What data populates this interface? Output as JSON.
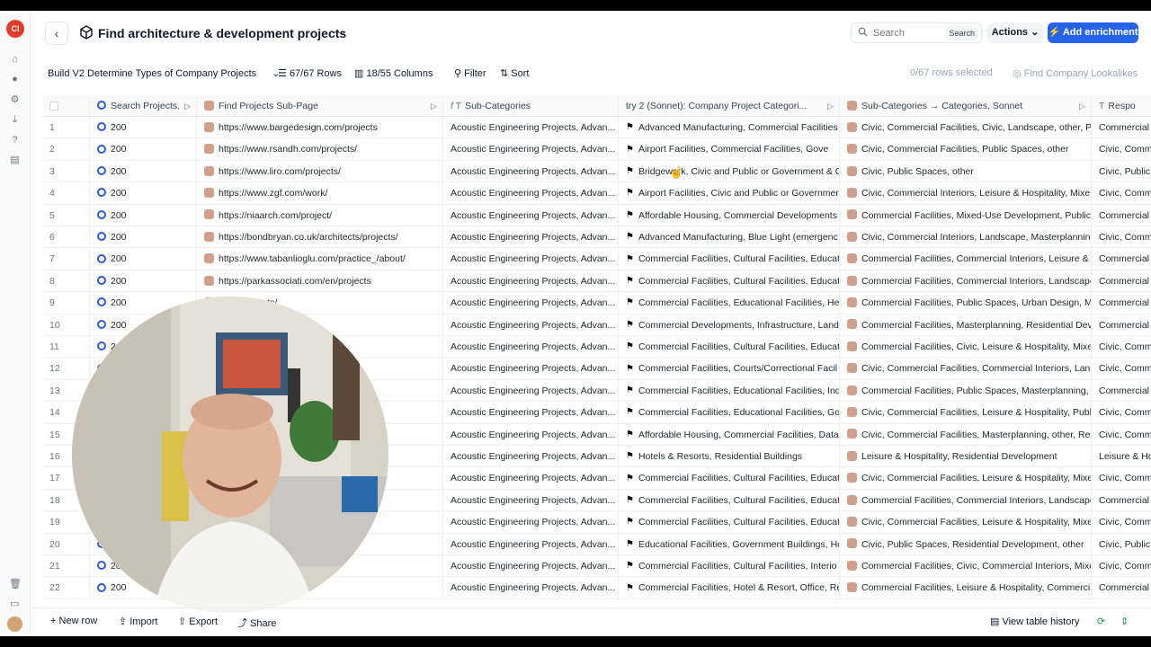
{
  "rail": {
    "logo": "Cl",
    "icons": [
      "home-icon",
      "bell-icon",
      "settings-icon",
      "download-icon",
      "help-icon",
      "table-icon",
      "trash-icon",
      "card-icon"
    ]
  },
  "header": {
    "title": "Find architecture & development projects",
    "more": "···",
    "search_placeholder": "Search",
    "search_button": "Search",
    "actions_label": "Actions",
    "enrich_label": "Add enrichment"
  },
  "toolbar": {
    "view_name": "Build V2 Determine Types of Company Projects",
    "rows": "67/67 Rows",
    "columns": "18/55 Columns",
    "filter": "Filter",
    "sort": "Sort",
    "selected": "0/67 rows selected",
    "lookalikes": "Find Company Lookalikes"
  },
  "columns": [
    "Search Projects.",
    "Find Projects Sub-Page",
    "Sub-Categories",
    "try 2 (Sonnet): Company Project Categori...",
    "Sub-Categories → Categories, Sonnet",
    "Respo"
  ],
  "rows": [
    {
      "n": "1",
      "status": "200",
      "url": "https://www.bargedesign.com/projects",
      "sub": "Acoustic Engineering Projects, Advan...",
      "cat": "Advanced Manufacturing, Commercial Facilities",
      "son": "Civic, Commercial Facilities, Civic, Landscape, other, Public S",
      "resp": "Commercial F"
    },
    {
      "n": "2",
      "status": "200",
      "url": "https://www.rsandh.com/projects/",
      "sub": "Acoustic Engineering Projects, Advan...",
      "cat": "Airport Facilities, Commercial Facilities, Gove",
      "son": "Civic, Commercial Facilities, Public Spaces, other",
      "resp": "Civic, Comme"
    },
    {
      "n": "3",
      "status": "200",
      "url": "https://www.liro.com/projects/",
      "sub": "Acoustic Engineering Projects, Advan...",
      "cat": "Bridgework, Civic and Public or Government & C",
      "son": "Civic, Public Spaces, other",
      "resp": "Civic, Public S"
    },
    {
      "n": "4",
      "status": "200",
      "url": "https://www.zgf.com/work/",
      "sub": "Acoustic Engineering Projects, Advan...",
      "cat": "Airport Facilities, Civic and Public or Governmer",
      "son": "Civic, Commercial Interiors, Leisure & Hospitality, Mixe",
      "resp": "Civic, Comme"
    },
    {
      "n": "5",
      "status": "200",
      "url": "https://niaarch.com/project/",
      "sub": "Acoustic Engineering Projects, Advan...",
      "cat": "Affordable Housing, Commercial Developments",
      "son": "Commercial Facilities, Mixed-Use Development, Public",
      "resp": "Commercial F"
    },
    {
      "n": "6",
      "status": "200",
      "url": "https://bondbryan.co.uk/architects/projects/",
      "sub": "Acoustic Engineering Projects, Advan...",
      "cat": "Advanced Manufacturing, Blue Light (emergenc",
      "son": "Civic, Commercial Interiors, Landscape, Masterplannin",
      "resp": "Civic, Comme"
    },
    {
      "n": "7",
      "status": "200",
      "url": "https://www.tabanlioglu.com/practice_/about/",
      "sub": "Acoustic Engineering Projects, Advan...",
      "cat": "Commercial Facilities, Cultural Facilities, Educat",
      "son": "Commercial Facilities, Commercial Interiors, Leisure & I",
      "resp": "Commercial F"
    },
    {
      "n": "8",
      "status": "200",
      "url": "https://parkassociati.com/en/projects",
      "sub": "Acoustic Engineering Projects, Advan...",
      "cat": "Commercial Facilities, Cultural Facilities, Educat",
      "son": "Commercial Facilities, Commercial Interiors, Landscape",
      "resp": "Commercial F"
    },
    {
      "n": "9",
      "status": "200",
      "url": ".com/projects/",
      "sub": "Acoustic Engineering Projects, Advan...",
      "cat": "Commercial Facilities, Educational Facilities, He",
      "son": "Commercial Facilities, Public Spaces, Urban Design, Mi",
      "resp": "Commercial F"
    },
    {
      "n": "10",
      "status": "200",
      "url": "/all-projects",
      "sub": "Acoustic Engineering Projects, Advan...",
      "cat": "Commercial Developments, Infrastructure, Land",
      "son": "Commercial Facilities, Masterplanning, Residential Dev",
      "resp": "Commercial F"
    },
    {
      "n": "11",
      "status": "200",
      "url": "/",
      "sub": "Acoustic Engineering Projects, Advan...",
      "cat": "Commercial Facilities, Cultural Facilities, Educat",
      "son": "Commercial Facilities, Civic, Leisure & Hospitality, Mixe",
      "resp": "Civic, Comme"
    },
    {
      "n": "12",
      "status": "200",
      "url": "rchitecture",
      "sub": "Acoustic Engineering Projects, Advan...",
      "cat": "Commercial Facilities, Courts/Correctional Facil",
      "son": "Civic, Commercial Facilities, Commercial Interiors, Lanc",
      "resp": "Civic, Comme"
    },
    {
      "n": "13",
      "status": "200",
      "url": "folio",
      "sub": "Acoustic Engineering Projects, Advan...",
      "cat": "Commercial Facilities, Educational Facilities, Ind",
      "son": "Commercial Facilities, Public Spaces, Masterplanning, I",
      "resp": "Commercial F"
    },
    {
      "n": "14",
      "status": "200",
      "url": "",
      "sub": "Acoustic Engineering Projects, Advan...",
      "cat": "Commercial Facilities, Educational Facilities, Go",
      "son": "Civic, Commercial Facilities, Leisure & Hospitality, Publ",
      "resp": "Civic, Comme"
    },
    {
      "n": "15",
      "status": "200",
      "url": "y/our-projec",
      "sub": "Acoustic Engineering Projects, Advan...",
      "cat": "Affordable Housing, Commercial Facilities, Data",
      "son": "Civic, Commercial Facilities, Masterplanning, other, Res",
      "resp": "Civic, Comme"
    },
    {
      "n": "16",
      "status": "200",
      "url": "",
      "sub": "Acoustic Engineering Projects, Advan...",
      "cat": "Hotels & Resorts, Residential Buildings",
      "son": "Leisure & Hospitality, Residential Development",
      "resp": "Leisure & Ho"
    },
    {
      "n": "17",
      "status": "200",
      "url": "",
      "sub": "Acoustic Engineering Projects, Advan...",
      "cat": "Commercial Facilities, Cultural Facilities, Educat",
      "son": "Civic, Commercial Facilities, Leisure & Hospitality, Mixe",
      "resp": "Civic, Comme"
    },
    {
      "n": "18",
      "status": "200",
      "url": "",
      "sub": "Acoustic Engineering Projects, Advan...",
      "cat": "Commercial Facilities, Cultural Facilities, Educat",
      "son": "Commercial Facilities, Commercial Interiors, Landscape",
      "resp": "Commercial F"
    },
    {
      "n": "19",
      "status": "200",
      "url": "",
      "sub": "Acoustic Engineering Projects, Advan...",
      "cat": "Commercial Facilities, Cultural Facilities, Educat",
      "son": "Civic, Commercial Facilities, Leisure & Hospitality, Mixe",
      "resp": "Civic, Comme"
    },
    {
      "n": "20",
      "status": "200",
      "url": "ers.co.uk/",
      "sub": "Acoustic Engineering Projects, Advan...",
      "cat": "Educational Facilities, Government Buildings, Hc",
      "son": "Civic, Public Spaces, Residential Development, other",
      "resp": "Civic, Public S"
    },
    {
      "n": "21",
      "status": "200",
      "url": "projects",
      "sub": "Acoustic Engineering Projects, Advan...",
      "cat": "Commercial Facilities, Cultural Facilities, Interio",
      "son": "Commercial Facilities, Civic, Commercial Interiors, Mixe",
      "resp": "Civic, Comme"
    },
    {
      "n": "22",
      "status": "200",
      "url": "kett-heese.de/en/",
      "sub": "Acoustic Engineering Projects, Advan...",
      "cat": "Commercial Facilities, Hotel & Resort, Office, Re",
      "son": "Commercial Facilities, Leisure & Hospitality, Commercia",
      "resp": "Commercial F"
    }
  ],
  "footer": {
    "new_row": "New row",
    "import": "Import",
    "export": "Export",
    "share": "Share",
    "history": "View table history"
  },
  "colors": {
    "accent": "#2563eb",
    "logo": "#e23d28"
  }
}
